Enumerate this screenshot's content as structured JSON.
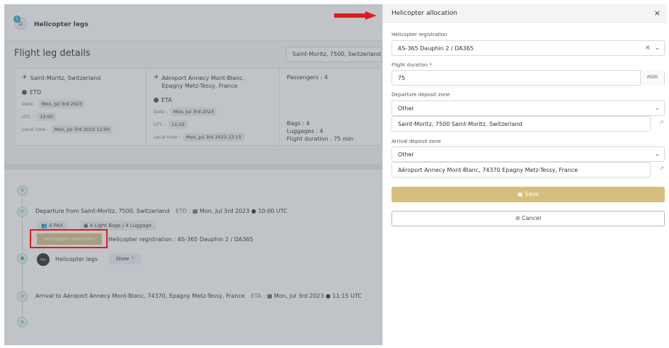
{
  "breadcrumb": {
    "badge": "5",
    "title": "Helicopter legs"
  },
  "details": {
    "title": "Flight leg details",
    "route_select": "Saint-Moritz, 7500, Switzerland",
    "departure": {
      "place": "Saint-Moritz, Switzerland",
      "label": "ETD",
      "date_label": "Date :",
      "date": "Mon, Jul 3rd 2023",
      "utc_label": "UTC :",
      "utc": "10:00",
      "local_label": "Local time :",
      "local": "Mon, Jul 3rd 2023 12:00"
    },
    "arrival": {
      "place_line1": "Aéroport Annecy Mont-Blanc,",
      "place_line2": "Epagny Metz-Tessy, France",
      "label": "ETA",
      "date_label": "Date :",
      "date": "Mon, Jul 3rd 2023",
      "utc_label": "UTC :",
      "utc": "11:15",
      "local_label": "Local time :",
      "local": "Mon, Jul 3rd 2023 13:15"
    },
    "passengers": "Passengers : 4",
    "bags": "Bags : 4",
    "luggages": "Luggages : 4",
    "flight_duration": "Flight duration : 75 min"
  },
  "timeline": {
    "departure_text": "Departure from Saint-Moritz, 7500, Switzerland",
    "departure_etd": "ETD :",
    "departure_date": "Mon, Jul 3rd 2023",
    "departure_time": "10:00 UTC",
    "pax_chip": "4 PAX",
    "bags_chip": "4 Light Bags / 4 Luggage",
    "alloc_button": "Helicopter allocation",
    "registration_text": "Helicopter registration : AS-365 Dauphin 2 / DA365",
    "legs_label": "Helicopter legs",
    "show_button": "Show",
    "arrival_text": "Arrival to Aéroport Annecy Mont-Blanc, 74370, Epagny Metz-Tessy, France",
    "arrival_eta": "ETA :",
    "arrival_date": "Mon, Jul 3rd 2023",
    "arrival_time": "11:15 UTC"
  },
  "drawer": {
    "title": "Helicopter allocation",
    "registration_label": "Helicopter registration",
    "registration_value": "AS-365 Dauphin 2 / DA365",
    "duration_label": "Flight duration *",
    "duration_value": "75",
    "duration_unit": "min",
    "departure_zone_label": "Departure deposit zone",
    "departure_zone_value": "Other",
    "departure_address": "Saint-Moritz, 7500 Saint-Moritz, Switzerland",
    "arrival_zone_label": "Arrival deposit zone",
    "arrival_zone_value": "Other",
    "arrival_address": "Aéroport Annecy Mont-Blanc, 74370 Epagny Metz-Tessy, France",
    "save_label": "Save",
    "cancel_label": "Cancel"
  },
  "colors": {
    "accent": "#d6bf7c",
    "annotation": "#e01b1b",
    "link": "#d8a52a"
  }
}
